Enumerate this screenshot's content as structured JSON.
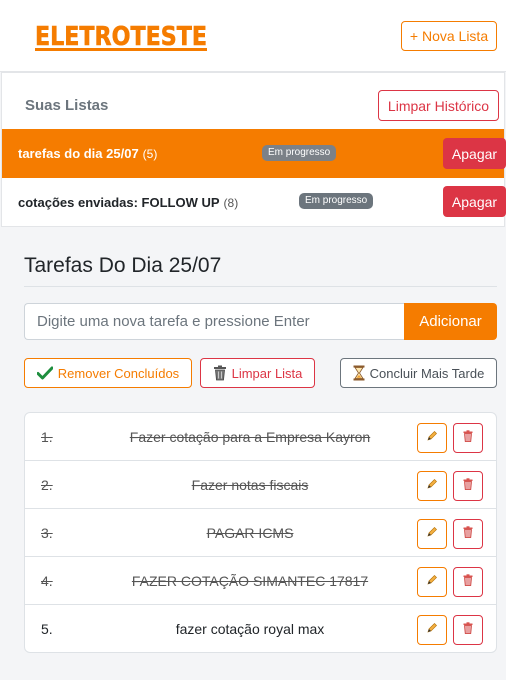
{
  "app": {
    "logo_text": "ELETROTESTE",
    "new_list_label": "+ Nova Lista"
  },
  "lists_panel": {
    "title": "Suas Listas",
    "clear_history_label": "Limpar Histórico",
    "items": [
      {
        "name": "tarefas do dia 25/07",
        "count": "(5)",
        "status": "Em progresso",
        "delete_label": "Apagar",
        "active": true
      },
      {
        "name": "cotações enviadas: FOLLOW UP",
        "count": "(8)",
        "status": "Em progresso",
        "delete_label": "Apagar",
        "active": false
      }
    ]
  },
  "current_list": {
    "title": "Tarefas Do Dia 25/07",
    "input_placeholder": "Digite uma nova tarefa e pressione Enter",
    "add_label": "Adicionar",
    "actions": {
      "remove_done_label": "Remover Concluídos",
      "clear_list_label": "Limpar Lista",
      "later_label": "Concluir Mais Tarde"
    },
    "tasks": [
      {
        "num": "1.",
        "text": "Fazer cotação para a Empresa Kayron",
        "done": true
      },
      {
        "num": "2.",
        "text": "Fazer notas fiscais",
        "done": true
      },
      {
        "num": "3.",
        "text": "PAGAR ICMS",
        "done": true
      },
      {
        "num": "4.",
        "text": "FAZER COTAÇÃO SIMANTEC 17817",
        "done": true
      },
      {
        "num": "5.",
        "text": "fazer cotação royal max",
        "done": false
      }
    ]
  },
  "colors": {
    "accent": "#f57c00",
    "danger": "#dc3545",
    "secondary": "#6c757d"
  }
}
